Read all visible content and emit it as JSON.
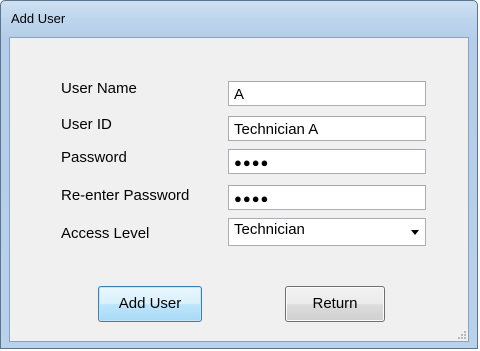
{
  "window": {
    "title": "Add User"
  },
  "form": {
    "user_name": {
      "label": "User Name",
      "value": "A"
    },
    "user_id": {
      "label": "User ID",
      "value": "Technician A"
    },
    "password": {
      "label": "Password",
      "value": "●●●●"
    },
    "reenter_password": {
      "label": "Re-enter Password",
      "value": "●●●●"
    },
    "access_level": {
      "label": "Access Level",
      "value": "Technician"
    }
  },
  "buttons": {
    "add_user": "Add User",
    "return": "Return"
  },
  "icons": {
    "dropdown": "chevron-down-icon",
    "resize": "resize-grip-icon"
  },
  "colors": {
    "frame": "#b9d1ea",
    "client": "#f0f0f0",
    "primary_button_border": "#3c7fb1"
  }
}
